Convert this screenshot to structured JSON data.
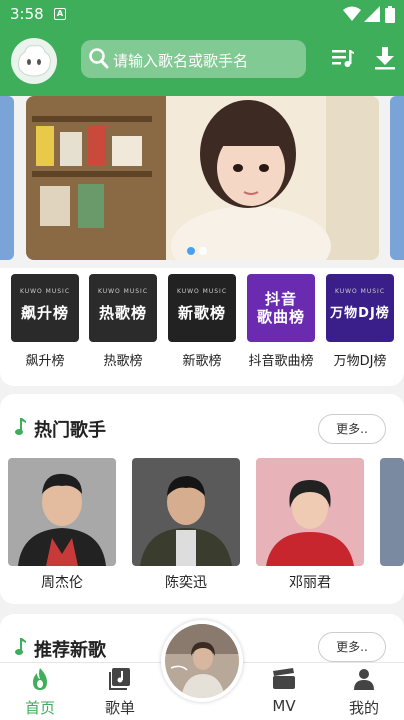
{
  "status": {
    "time": "3:58",
    "notif": "A"
  },
  "header": {
    "search_placeholder": "请输入歌名或歌手名"
  },
  "ranks": [
    {
      "label": "飙升榜",
      "cover_text": "飙升榜",
      "cover_brand": "KUWO MUSIC"
    },
    {
      "label": "热歌榜",
      "cover_text": "热歌榜",
      "cover_brand": "KUWO MUSIC"
    },
    {
      "label": "新歌榜",
      "cover_text": "新歌榜",
      "cover_brand": "KUWO MUSIC"
    },
    {
      "label": "抖音歌曲榜",
      "cover_text": "抖音\n歌曲榜",
      "cover_brand": ""
    },
    {
      "label": "万物DJ榜",
      "cover_text": "万物DJ榜",
      "cover_brand": "KUWO MUSIC"
    }
  ],
  "hot_singers": {
    "title": "热门歌手",
    "more": "更多..",
    "singers": [
      {
        "name": "周杰伦"
      },
      {
        "name": "陈奕迅"
      },
      {
        "name": "邓丽君"
      }
    ]
  },
  "new_songs": {
    "title": "推荐新歌",
    "more": "更多.."
  },
  "nav": {
    "home": "首页",
    "playlist": "歌单",
    "mv": "MV",
    "mine": "我的"
  },
  "colors": {
    "accent": "#3fae5a",
    "dot_active": "#4aa0f0"
  }
}
